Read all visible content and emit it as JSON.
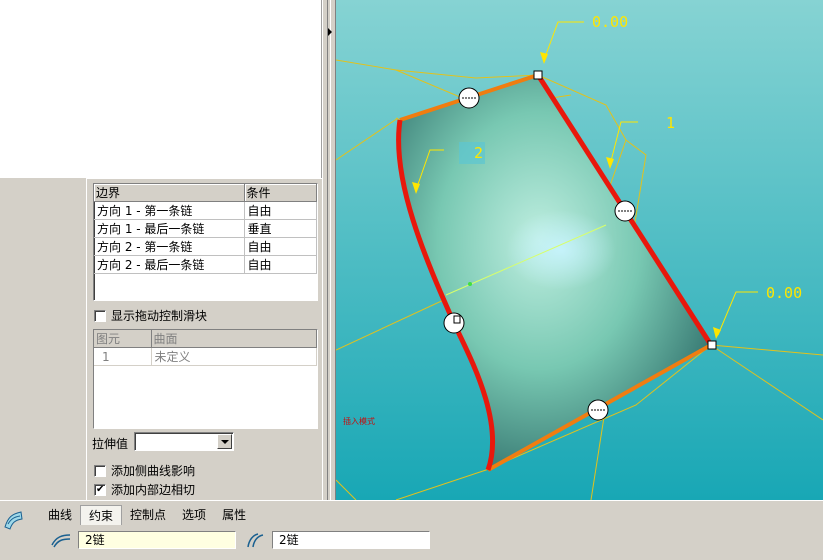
{
  "left_panel": {
    "boundary_table": {
      "headers": [
        "边界",
        "条件"
      ],
      "rows": [
        {
          "boundary": "方向 1 - 第一条链",
          "condition": "自由"
        },
        {
          "boundary": "方向 1 - 最后一条链",
          "condition": "垂直"
        },
        {
          "boundary": "方向 2 - 第一条链",
          "condition": "自由"
        },
        {
          "boundary": "方向 2 - 最后一条链",
          "condition": "自由"
        }
      ]
    },
    "show_drag_handles": {
      "label": "显示拖动控制滑块",
      "checked": false
    },
    "element_table": {
      "headers": [
        "图元",
        "曲面"
      ],
      "rows": [
        {
          "element": "1",
          "surface": "未定义"
        }
      ]
    },
    "stretch_value": {
      "label": "拉伸值",
      "value": ""
    },
    "add_side_curve": {
      "label": "添加侧曲线影响",
      "checked": false
    },
    "add_inner_edge": {
      "label": "添加内部边相切",
      "checked": true
    }
  },
  "viewport": {
    "annotations": [
      "0.00",
      "1",
      "2",
      "0.00"
    ],
    "mode_text": "插入模式",
    "colors": {
      "background_top": "#7fd0d2",
      "background_bottom": "#1ba8b6",
      "edge_red": "#e8180c",
      "edge_orange": "#f07d10",
      "frame": "#e0c020"
    }
  },
  "dashboard": {
    "tabs": [
      "曲线",
      "约束",
      "控制点",
      "选项",
      "属性"
    ],
    "active_tab": "约束",
    "chain1": "2链",
    "chain2": "2链"
  }
}
